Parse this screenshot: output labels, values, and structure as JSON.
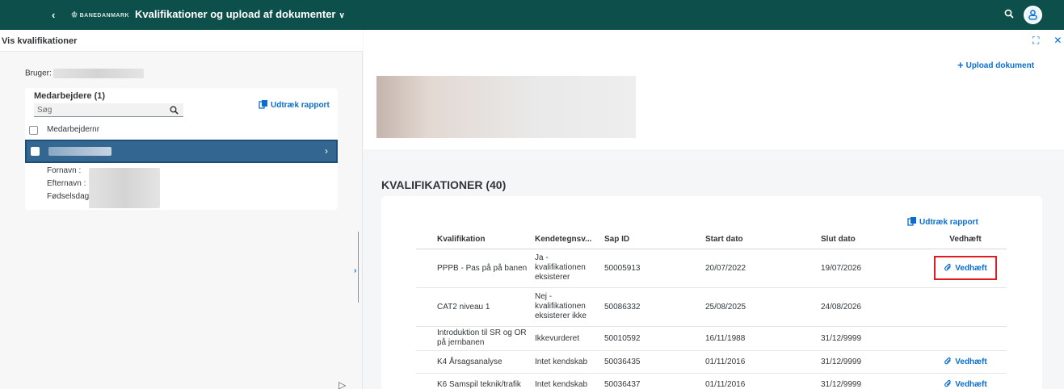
{
  "shell": {
    "back": "‹",
    "logo": "BANEDANMARK",
    "title": "Kvalifikationer og upload af dokumenter",
    "title_chevron": "∨"
  },
  "left": {
    "header": "Vis kvalifikationer",
    "user_label": "Bruger:",
    "list_title": "Medarbejdere (1)",
    "search_placeholder": "Søg",
    "report_label": "Udtræk rapport",
    "column_label": "Medarbejdernr",
    "details": [
      "Fornavn  :",
      "Efternavn  :",
      "Fødselsdag"
    ]
  },
  "right": {
    "upload_label": "Upload dokument",
    "section_title": "KVALIFIKATIONER (40)",
    "report_label": "Udtræk rapport",
    "columns": [
      "Kvalifikation",
      "Kendetegnsv...",
      "Sap ID",
      "Start dato",
      "Slut dato",
      "Vedhæft"
    ],
    "rows": [
      {
        "name": "PPPB - Pas på på banen",
        "kendetegn": "Ja - kvalifikationen eksisterer",
        "sap": "50005913",
        "start": "20/07/2022",
        "slut": "19/07/2026",
        "attach": "Vedhæft"
      },
      {
        "name": "CAT2 niveau 1",
        "kendetegn": "Nej - kvalifikationen eksisterer ikke",
        "sap": "50086332",
        "start": "25/08/2025",
        "slut": "24/08/2026",
        "attach": ""
      },
      {
        "name": "Introduktion til SR og OR på jernbanen",
        "kendetegn": "Ikkevurderet",
        "sap": "50010592",
        "start": "16/11/1988",
        "slut": "31/12/9999",
        "attach": ""
      },
      {
        "name": "K4 Årsagsanalyse",
        "kendetegn": "Intet kendskab",
        "sap": "50036435",
        "start": "01/11/2016",
        "slut": "31/12/9999",
        "attach": "Vedhæft"
      },
      {
        "name": "K6 Samspil teknik/trafik",
        "kendetegn": "Intet kendskab",
        "sap": "50036437",
        "start": "01/11/2016",
        "slut": "31/12/9999",
        "attach": "Vedhæft"
      }
    ]
  },
  "colors": {
    "shell": "#0d4f4a",
    "accent": "#0a6ed1",
    "selected": "#336690",
    "highlight": "#e11b22"
  }
}
